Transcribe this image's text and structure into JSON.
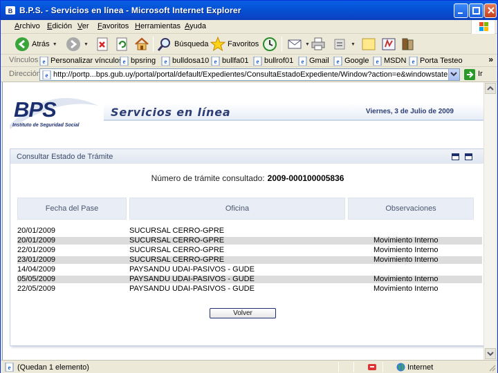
{
  "window": {
    "title": "B.P.S. - Servicios en línea - Microsoft Internet Explorer"
  },
  "menu": [
    "Archivo",
    "Edición",
    "Ver",
    "Favoritos",
    "Herramientas",
    "Ayuda"
  ],
  "toolbar": {
    "back_label": "Atrás",
    "search_label": "Búsqueda",
    "favorites_label": "Favoritos"
  },
  "links": {
    "title": "Vínculos",
    "items": [
      "Personalizar vínculos",
      "bpsring",
      "bulldosa10",
      "bullfa01",
      "bullrof01",
      "Gmail",
      "Google",
      "MSDN",
      "Porta Testeo"
    ]
  },
  "address": {
    "title": "Dirección",
    "url": "http://portp...bps.gub.uy/portal/portal/default/Expedientes/ConsultaEstadoExpediente/Window?action=e&windowstate=normal&mo",
    "go_label": "Ir"
  },
  "page": {
    "logo_text": "BPS",
    "logo_sub": "Instituto de Seguridad Social",
    "service_title": "Servicios en línea",
    "date": "Viernes, 3 de Julio de 2009",
    "panel_title": "Consultar Estado de Trámite",
    "tramite_label": "Número de trámite consultado:",
    "tramite_number": "2009-000100005836",
    "columns": [
      "Fecha del Pase",
      "Oficina",
      "Observaciones"
    ],
    "rows": [
      {
        "fecha": "20/01/2009",
        "oficina": "SUCURSAL CERRO-GPRE",
        "obs": ""
      },
      {
        "fecha": "20/01/2009",
        "oficina": "SUCURSAL CERRO-GPRE",
        "obs": "Movimiento Interno"
      },
      {
        "fecha": "22/01/2009",
        "oficina": "SUCURSAL CERRO-GPRE",
        "obs": "Movimiento Interno"
      },
      {
        "fecha": "23/01/2009",
        "oficina": "SUCURSAL CERRO-GPRE",
        "obs": "Movimiento Interno"
      },
      {
        "fecha": "14/04/2009",
        "oficina": "PAYSANDÚ UDAI-PASIVOS - GUDE",
        "obs": ""
      },
      {
        "fecha": "05/05/2009",
        "oficina": "PAYSANDÚ UDAI-PASIVOS - GUDE",
        "obs": "Movimiento Interno"
      },
      {
        "fecha": "22/05/2009",
        "oficina": "PAYSANDÚ UDAI-PASIVOS - GUDE",
        "obs": "Movimiento Interno"
      }
    ],
    "back_button": "Volver"
  },
  "status": {
    "text": "(Quedan 1 elemento)",
    "zone": "Internet"
  },
  "colors": {
    "titlebar": "#0553d6",
    "brand_navy": "#1b2e6e",
    "row_alt": "#dcdcdc",
    "header_cell": "#e9eef6"
  }
}
